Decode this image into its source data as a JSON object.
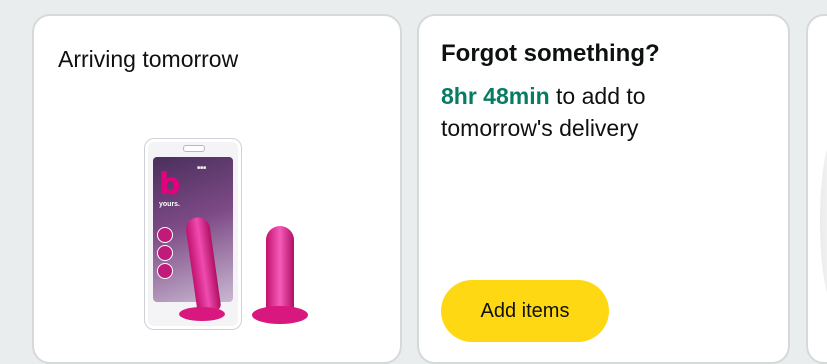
{
  "arriving_card": {
    "title": "Arriving tomorrow",
    "product_image": "pink-product-in-blister-pack"
  },
  "forgot_card": {
    "title": "Forgot something?",
    "countdown": "8hr 48min",
    "message_rest": " to add to tomorrow's delivery",
    "button_label": "Add items"
  },
  "colors": {
    "background": "#eaeded",
    "countdown_green": "#067d62",
    "button_yellow": "#ffd814",
    "card_border": "#d5d9d9"
  }
}
